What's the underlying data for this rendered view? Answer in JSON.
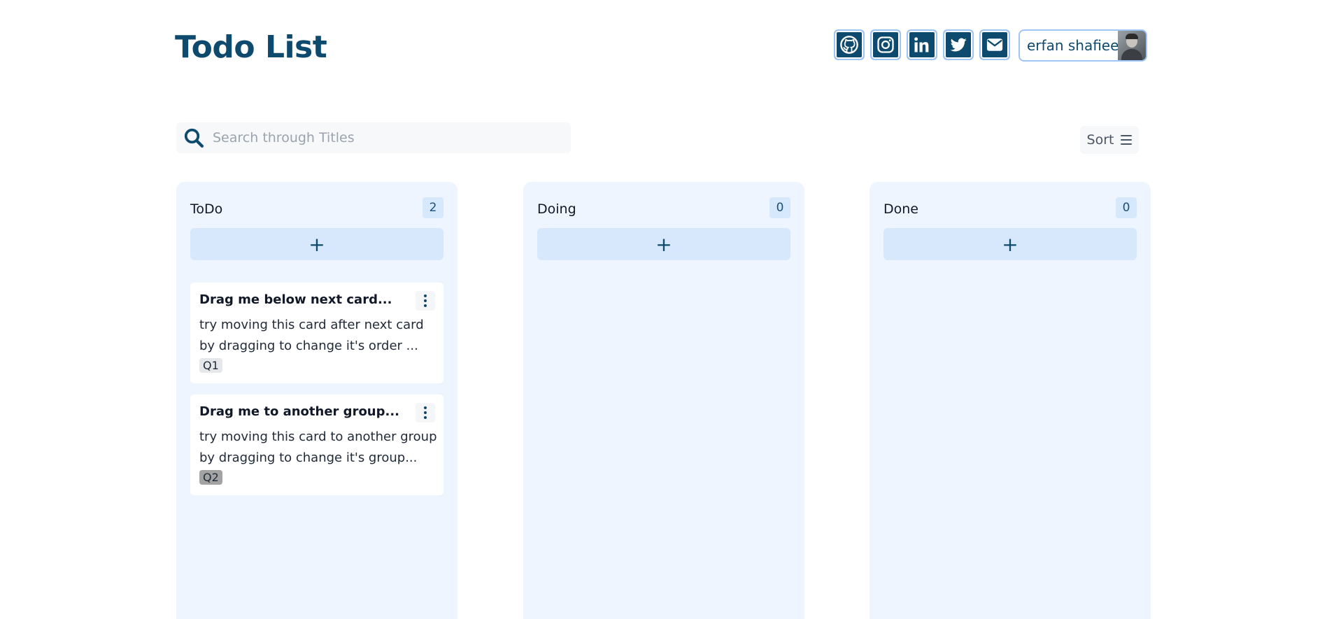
{
  "header": {
    "title": "Todo List",
    "socials": [
      {
        "icon": "github-icon"
      },
      {
        "icon": "instagram-icon"
      },
      {
        "icon": "linkedin-icon"
      },
      {
        "icon": "twitter-icon"
      },
      {
        "icon": "mail-icon"
      }
    ],
    "profile": {
      "name": "erfan shafiee"
    }
  },
  "search": {
    "placeholder": "Search through Titles",
    "value": ""
  },
  "sort": {
    "label": "Sort"
  },
  "columns": [
    {
      "title": "ToDo",
      "count": "2",
      "add_label": "+",
      "cards": [
        {
          "title": "Drag me below next card...",
          "line1": "try moving this card after next card",
          "line2": "by dragging to change it's order ...",
          "tag": "Q1",
          "tag_color": "#e5e7eb"
        },
        {
          "title": "Drag me to another group...",
          "line1": "try moving this card to another group",
          "line2": "by dragging to change it's group...",
          "tag": "Q2",
          "tag_color": "#a3a3a3"
        }
      ]
    },
    {
      "title": "Doing",
      "count": "0",
      "add_label": "+",
      "cards": []
    },
    {
      "title": "Done",
      "count": "0",
      "add_label": "+",
      "cards": []
    }
  ],
  "colors": {
    "brand": "#0e4a6e",
    "column_bg": "#eff5fe",
    "add_bg": "#d8e8fc",
    "count_bg": "#d6e8fb",
    "border_accent": "#9ec5f5"
  }
}
